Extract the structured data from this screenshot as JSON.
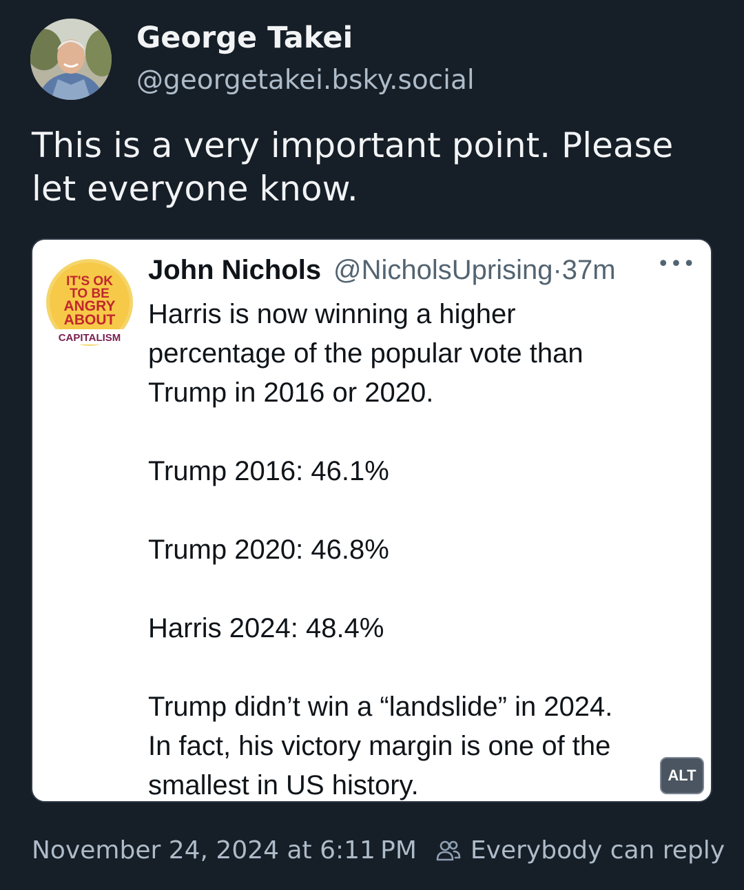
{
  "author": {
    "name": "George Takei",
    "handle": "@georgetakei.bsky.social"
  },
  "post": {
    "text": "This is a very important point. Please let everyone know."
  },
  "embed": {
    "quote_author_name": "John Nichols",
    "quote_handle_time": "@NicholsUprising·37m",
    "quote_avatar_text": [
      "IT'S OK",
      "TO BE",
      "ANGRY",
      "ABOUT",
      "CAPITALISM"
    ],
    "quote_lines": [
      "Harris is now winning a higher",
      "percentage of the popular vote than",
      "Trump in 2016 or 2020.",
      "",
      "Trump 2016: 46.1%",
      "",
      "Trump 2020: 46.8%",
      "",
      "Harris 2024: 48.4%",
      "",
      "Trump didn’t win a “landslide” in 2024.",
      "In fact, his victory margin is one of the",
      "smallest in US history."
    ],
    "alt_label": "ALT"
  },
  "footer": {
    "timestamp": "November 24, 2024 at 6:11 PM",
    "reply_setting": "Everybody can reply"
  },
  "colors": {
    "background": "#161e27",
    "text_primary": "#f1f3f5",
    "text_secondary": "#aebbc9"
  }
}
